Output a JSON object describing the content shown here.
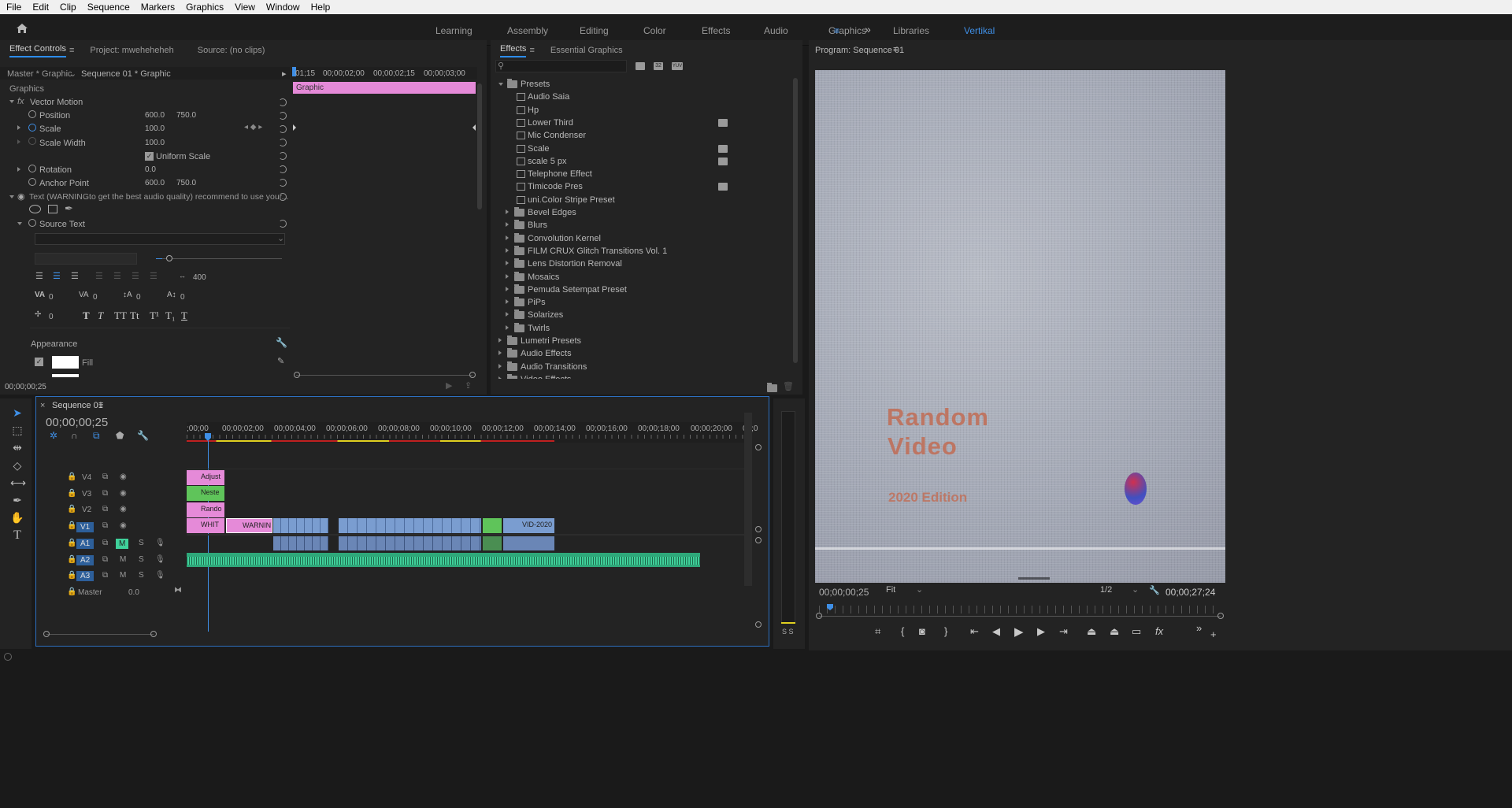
{
  "menubar": [
    "File",
    "Edit",
    "Clip",
    "Sequence",
    "Markers",
    "Graphics",
    "View",
    "Window",
    "Help"
  ],
  "workspaces": [
    "Learning",
    "Assembly",
    "Editing",
    "Color",
    "Effects",
    "Audio",
    "Graphics",
    "Libraries",
    "Vertikal"
  ],
  "active_workspace": "Vertikal",
  "effect_controls": {
    "tabs": [
      "Effect Controls",
      "Project: mweheheheh",
      "Source: (no clips)"
    ],
    "master": "Master * Graphic",
    "sequence": "Sequence 01 * Graphic",
    "ruler": [
      "01;15",
      "00;00;02;00",
      "00;00;02;15",
      "00;00;03;00"
    ],
    "clip_label": "Graphic",
    "section": "Graphics",
    "vector_motion": "Vector Motion",
    "fx": "fx",
    "props": [
      {
        "label": "Position",
        "v1": "600.0",
        "v2": "750.0"
      },
      {
        "label": "Scale",
        "v1": "100.0",
        "v2": ""
      },
      {
        "label": "Scale Width",
        "v1": "100.0",
        "v2": ""
      },
      {
        "label": "Rotation",
        "v1": "0.0",
        "v2": ""
      },
      {
        "label": "Anchor Point",
        "v1": "600.0",
        "v2": "750.0"
      }
    ],
    "uniform_scale": "Uniform Scale",
    "text_layer": "Text (WARNINGto get the best audio quality) recommend to use your...",
    "source_text": "Source Text",
    "tracking": "400",
    "kerning": "0",
    "kerning2": "0",
    "leading": "0",
    "baseline": "0",
    "tsume": "0",
    "appearance": "Appearance",
    "fill": "Fill",
    "timecode": "00;00;00;25",
    "style_buttons": [
      "T",
      "T",
      "TT",
      "Tt",
      "T¹",
      "T₁",
      "T"
    ]
  },
  "effects": {
    "tabs": [
      "Effects",
      "Essential Graphics"
    ],
    "tree": [
      {
        "label": "Presets",
        "level": 0,
        "type": "folder",
        "open": true
      },
      {
        "label": "Audio Saia",
        "level": 1,
        "type": "preset"
      },
      {
        "label": "Hp",
        "level": 1,
        "type": "preset"
      },
      {
        "label": "Lower Third",
        "level": 1,
        "type": "preset",
        "badge": true
      },
      {
        "label": "Mic Condenser",
        "level": 1,
        "type": "preset"
      },
      {
        "label": "Scale",
        "level": 1,
        "type": "preset",
        "badge": true
      },
      {
        "label": "scale 5 px",
        "level": 1,
        "type": "preset",
        "badge": true
      },
      {
        "label": "Telephone Effect",
        "level": 1,
        "type": "preset"
      },
      {
        "label": "Timicode Pres",
        "level": 1,
        "type": "preset",
        "badge": true
      },
      {
        "label": "uni.Color Stripe Preset",
        "level": 1,
        "type": "preset"
      },
      {
        "label": "Bevel Edges",
        "level": 1,
        "type": "folder"
      },
      {
        "label": "Blurs",
        "level": 1,
        "type": "folder"
      },
      {
        "label": "Convolution Kernel",
        "level": 1,
        "type": "folder"
      },
      {
        "label": "FILM CRUX Glitch Transitions Vol. 1",
        "level": 1,
        "type": "folder"
      },
      {
        "label": "Lens Distortion Removal",
        "level": 1,
        "type": "folder"
      },
      {
        "label": "Mosaics",
        "level": 1,
        "type": "folder"
      },
      {
        "label": "Pemuda Setempat Preset",
        "level": 1,
        "type": "folder"
      },
      {
        "label": "PiPs",
        "level": 1,
        "type": "folder"
      },
      {
        "label": "Solarizes",
        "level": 1,
        "type": "folder"
      },
      {
        "label": "Twirls",
        "level": 1,
        "type": "folder"
      },
      {
        "label": "Lumetri Presets",
        "level": 0,
        "type": "folder"
      },
      {
        "label": "Audio Effects",
        "level": 0,
        "type": "folder"
      },
      {
        "label": "Audio Transitions",
        "level": 0,
        "type": "folder"
      },
      {
        "label": "Video Effects",
        "level": 0,
        "type": "folder"
      }
    ]
  },
  "program": {
    "title": "Program: Sequence 01",
    "title_line1": "Random",
    "title_line2": "Video",
    "edition": "2020 Edition",
    "timecode": "00;00;00;25",
    "fit": "Fit",
    "resolution": "1/2",
    "duration": "00;00;27;24"
  },
  "timeline": {
    "title": "Sequence 01",
    "timecode": "00;00;00;25",
    "ruler": [
      ";00;00",
      "00;00;02;00",
      "00;00;04;00",
      "00;00;06;00",
      "00;00;08;00",
      "00;00;10;00",
      "00;00;12;00",
      "00;00;14;00",
      "00;00;16;00",
      "00;00;18;00",
      "00;00;20;00",
      "00;0"
    ],
    "video_tracks": [
      "V4",
      "V3",
      "V2",
      "V1"
    ],
    "audio_tracks": [
      "A1",
      "A2",
      "A3"
    ],
    "master": "Master",
    "master_val": "0.0",
    "clips": {
      "adjust": "Adjust",
      "neste": "Neste",
      "rando": "Rando",
      "whit": "WHIT",
      "warnin": "WARNIN",
      "vid": "VID-2020"
    },
    "ms": [
      "M",
      "S"
    ]
  },
  "meters": "S S"
}
